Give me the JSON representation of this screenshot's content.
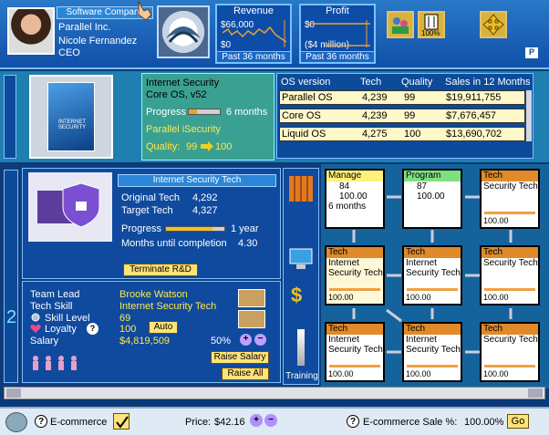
{
  "header": {
    "company_button": "Software Company",
    "company_name": "Parallel Inc.",
    "ceo_name": "Nicole Fernandez",
    "ceo_title": "CEO",
    "revenue": {
      "title": "Revenue",
      "top": "$66,000",
      "bottom": "$0",
      "period": "Past 36 months"
    },
    "profit": {
      "title": "Profit",
      "top": "$0",
      "bottom": "($4 million)",
      "period": "Past 36 months"
    },
    "percent_badge": "100%",
    "p_badge": "P"
  },
  "product": {
    "box_label": "INTERNET SECURITY",
    "name": "Internet Security",
    "platform": "Core OS, v52",
    "progress_label": "Progress",
    "progress_value": "6 months",
    "progress_fraction": 0.25,
    "brand": "Parallel iSecurity",
    "quality_label": "Quality:",
    "quality_from": "99",
    "quality_to": "100"
  },
  "os_table": {
    "headers": [
      "OS version",
      "Tech",
      "Quality",
      "Sales in 12 Months"
    ],
    "rows": [
      {
        "name": "Parallel OS",
        "tech": "4,239",
        "quality": "99",
        "sales": "$19,911,755"
      },
      {
        "name": "Core OS",
        "tech": "4,239",
        "quality": "99",
        "sales": "$7,676,457"
      },
      {
        "name": "Liquid OS",
        "tech": "4,275",
        "quality": "100",
        "sales": "$13,690,702"
      }
    ]
  },
  "rd": {
    "title": "Internet Security Tech",
    "original_label": "Original Tech",
    "original_value": "4,292",
    "target_label": "Target Tech",
    "target_value": "4,327",
    "progress_label": "Progress",
    "progress_value": "1 year",
    "progress_fraction": 0.8,
    "months_label": "Months until completion",
    "months_value": "4.30",
    "terminate": "Terminate R&D"
  },
  "team": {
    "lead_label": "Team Lead",
    "lead_value": "Brooke Watson",
    "skill_label": "Tech Skill",
    "skill_value": "Internet Security Tech",
    "level_label": "Skill Level",
    "level_value": "69",
    "loyalty_label": "Loyalty",
    "loyalty_value": "100",
    "auto": "Auto",
    "salary_label": "Salary",
    "salary_value": "$4,819,509",
    "pct": "50%",
    "raise_salary": "Raise Salary",
    "raise_all": "Raise All"
  },
  "side": {
    "training": "Training"
  },
  "cards": [
    {
      "header": "Manage",
      "tech": "84",
      "score": "100.00",
      "note": "6 months",
      "color": "#fff27a"
    },
    {
      "header": "Program",
      "tech": "87",
      "score": "100.00",
      "note": "",
      "color": "#7fe07f"
    },
    {
      "header": "Tech",
      "line1": "Security Tech",
      "score": "100.00",
      "color": "#e08a2a"
    },
    {
      "header": "Tech",
      "line1": "Internet",
      "line2": "Security Tech",
      "score": "100.00",
      "color": "#e08a2a"
    },
    {
      "header": "Tech",
      "line1": "Internet",
      "line2": "Security Tech",
      "score": "100.00",
      "color": "#e08a2a"
    },
    {
      "header": "Tech",
      "line1": "Security Tech",
      "score": "100.00",
      "color": "#e08a2a"
    },
    {
      "header": "Tech",
      "line1": "Internet",
      "line2": "Security Tech",
      "score": "100.00",
      "color": "#e08a2a"
    },
    {
      "header": "Tech",
      "line1": "Internet",
      "line2": "Security Tech",
      "score": "100.00",
      "color": "#e08a2a"
    },
    {
      "header": "Tech",
      "line1": "Security Tech",
      "score": "100.00",
      "color": "#e08a2a"
    }
  ],
  "status": {
    "ecommerce": "E-commerce",
    "price_label": "Price:",
    "price_value": "$42.16",
    "sale_label": "E-commerce Sale %:",
    "sale_value": "100.00%",
    "go": "Go"
  }
}
